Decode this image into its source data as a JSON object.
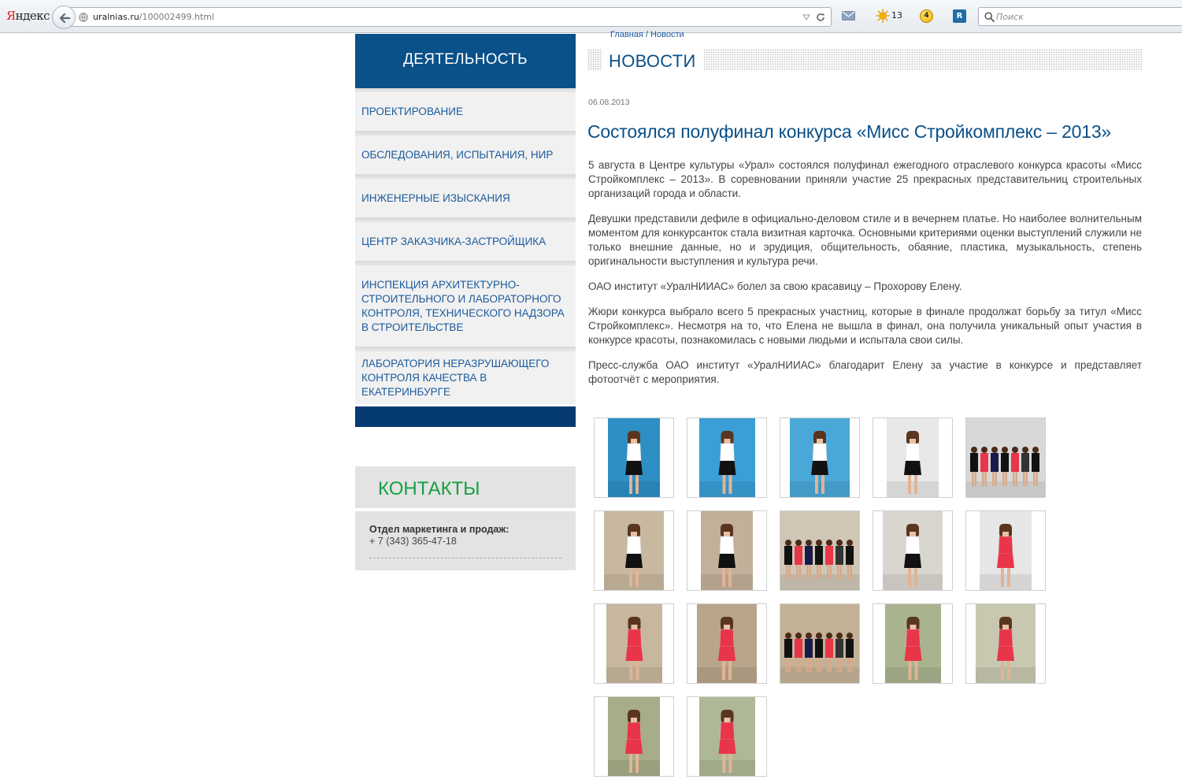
{
  "browser": {
    "brand_first": "Я",
    "brand_rest": "ндекс",
    "url_host": "uralnias.ru",
    "url_path": "/100002499.html",
    "weather_temp": "13",
    "traffic_level": "4",
    "ext_label": "R",
    "search_placeholder": "Поиск"
  },
  "sidebar": {
    "activity_title": "ДЕЯТЕЛЬНОСТЬ",
    "items": [
      {
        "label": "ПРОЕКТИРОВАНИЕ"
      },
      {
        "label": "ОБСЛЕДОВАНИЯ, ИСПЫТАНИЯ, НИР"
      },
      {
        "label": "ИНЖЕНЕРНЫЕ ИЗЫСКАНИЯ"
      },
      {
        "label": "ЦЕНТР ЗАКАЗЧИКА-ЗАСТРОЙЩИКА"
      },
      {
        "label": "ИНСПЕКЦИЯ АРХИТЕКТУРНО-СТРОИТЕЛЬНОГО И ЛАБОРАТОРНОГО КОНТРОЛЯ, ТЕХНИЧЕСКОГО НАДЗОРА В СТРОИТЕЛЬСТВЕ"
      },
      {
        "label": "ЛАБОРАТОРИЯ НЕРАЗРУШАЮЩЕГО КОНТРОЛЯ КАЧЕСТВА В ЕКАТЕРИНБУРГЕ"
      }
    ],
    "contacts_title": "КОНТАКТЫ",
    "contacts_dept": "Отдел маркетинга и продаж:",
    "contacts_phone": "+ 7 (343) 365-47-18"
  },
  "breadcrumb": {
    "home": "Главная",
    "separator": " / ",
    "current": "Новости"
  },
  "news": {
    "section_title": "НОВОСТИ",
    "date": "06.08.2013",
    "headline": "Состоялся полуфинал конкурса «Мисс Стройкомплекс – 2013»",
    "paragraphs": [
      "5 августа в Центре культуры «Урал» состоялся полуфинал ежегодного отраслевого конкурса красоты «Мисс Стройкомплекс – 2013». В соревновании приняли участие 25 прекрасных представительниц строительных организаций города и области.",
      "Девушки представили дефиле в официально-деловом стиле и в вечернем платье. Но наиболее волнительным моментом для конкурсанток стала визитная карточка. Основными критериями оценки выступлений служили не только внешние данные, но и эрудиция, общительность, обаяние, пластика, музыкальность, степень оригинальности выступления и культура речи.",
      "ОАО институт «УралНИИАС» болел за свою красавицу – Прохорову Елену.",
      "Жюри конкурса выбрало всего 5 прекрасных участниц, которые в финале продолжат борьбу за титул «Мисс Стройкомплекс». Несмотря на то, что Елена не вышла в финал, она получила уникальный опыт участия в конкурсе красоты, познакомилась с новыми людьми и испытала свои силы.",
      "Пресс-служба ОАО институт «УралНИИАС» благодарит Елену за участие в конкурсе и представляет фотоотчёт с мероприятия."
    ]
  },
  "colors": {
    "brand_blue": "#0a5089",
    "link_blue": "#1b5a9c",
    "contacts_green": "#16a042",
    "dress_white_black": "#ffffff",
    "dress_red": "#e8354a"
  },
  "gallery": [
    {
      "bg": "#2d8fc4",
      "dress": "white"
    },
    {
      "bg": "#3a9fd6",
      "dress": "white"
    },
    {
      "bg": "#4aa8d8",
      "dress": "white"
    },
    {
      "bg": "#e8e8e8",
      "dress": "white"
    },
    {
      "bg": "#d8d8d8",
      "dress": "group"
    },
    {
      "bg": "#c9b8a0",
      "dress": "white"
    },
    {
      "bg": "#c2b09a",
      "dress": "white"
    },
    {
      "bg": "#cfc6b6",
      "dress": "group"
    },
    {
      "bg": "#d9d6d0",
      "dress": "white"
    },
    {
      "bg": "#e6e6e6",
      "dress": "red"
    },
    {
      "bg": "#c7b79f",
      "dress": "red"
    },
    {
      "bg": "#b8a58a",
      "dress": "red"
    },
    {
      "bg": "#c4b298",
      "dress": "group"
    },
    {
      "bg": "#a9b48f",
      "dress": "red"
    },
    {
      "bg": "#c8c8b0",
      "dress": "red"
    },
    {
      "bg": "#a6ad88",
      "dress": "red"
    },
    {
      "bg": "#aeb896",
      "dress": "red"
    }
  ]
}
